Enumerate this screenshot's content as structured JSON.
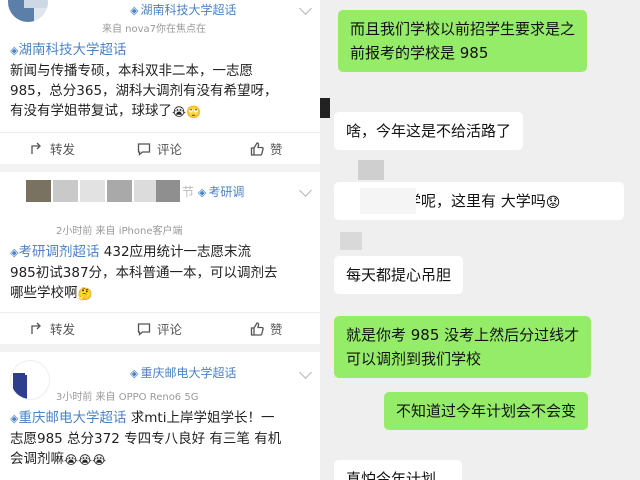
{
  "feed": {
    "posts": [
      {
        "author_tag": "湖南科技大学超话",
        "sub_meta": "来自 nova7你在焦点在",
        "topic": "湖南科技大学超话",
        "lines": [
          "新闻与传播专硕，本科双非二本，一志愿",
          "985，总分365，湖科大调剂有没有希望呀，",
          "有没有学姐带复试，球球了"
        ],
        "emoji": [
          "😭",
          "🙄"
        ],
        "actions": {
          "forward": "转发",
          "comment": "评论",
          "like": "赞"
        }
      },
      {
        "author_tag": "考研调",
        "name_fragment": "节",
        "sub_meta": "2小时前  来自 iPhone客户端",
        "topic": "考研调剂超话",
        "lines": [
          " 432应用统计一志愿末流",
          "985初试387分，本科普通一本，可以调剂去",
          "哪些学校啊"
        ],
        "emoji": [
          "🤔"
        ],
        "actions": {
          "forward": "转发",
          "comment": "评论",
          "like": "赞"
        }
      },
      {
        "author_tag": "重庆邮电大学超话",
        "sub_meta": "3小时前  来自 OPPO Reno6 5G",
        "topic": "重庆邮电大学超话",
        "lines": [
          " 求mti上岸学姐学长！一",
          "志愿985 总分372 专四专八良好 有三笔 有机",
          "会调剂嘛"
        ],
        "emoji": [
          "😭",
          "😭",
          "😭"
        ]
      }
    ]
  },
  "chat": {
    "messages": [
      {
        "side": "green",
        "lines": [
          "而且我们学校以前招学生要求是之",
          "前报考的学校是 985"
        ]
      },
      {
        "side": "white",
        "lines": [
          "啥，今年这是不给活路了"
        ]
      },
      {
        "side": "white",
        "lines": [
          "学呢，这里有      大学吗"
        ],
        "emoji": "😟"
      },
      {
        "side": "white",
        "lines": [
          "每天都提心吊胆"
        ]
      },
      {
        "side": "green",
        "lines": [
          "就是你考 985 没考上然后分过线才",
          "可以调剂到我们学校"
        ]
      },
      {
        "side": "green",
        "lines": [
          "不知道过今年计划会不会变"
        ]
      },
      {
        "side": "white",
        "lines": [
          "真怕今年计划..."
        ]
      }
    ]
  },
  "colors": {
    "topic_blue": "#4a83c6",
    "chat_green": "#95ec69",
    "chat_bg": "#efefef"
  }
}
